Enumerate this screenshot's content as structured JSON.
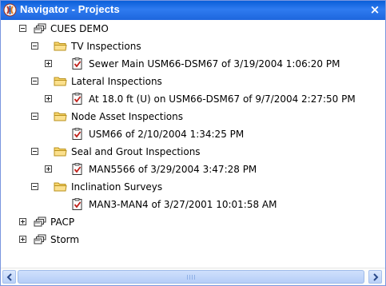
{
  "window": {
    "title": "Navigator - Projects",
    "close_glyph": "×",
    "colors": {
      "titlebar": "#1d66dd",
      "border": "#7a96df",
      "folder": "#f5c945"
    }
  },
  "tree": {
    "root": {
      "label": "CUES DEMO",
      "icon": "project-icon",
      "expanded": true
    },
    "folders": [
      {
        "label": "TV Inspections",
        "expanded": true,
        "items": [
          {
            "label": "Sewer Main USM66-DSM67 of 3/19/2004 1:06:20 PM",
            "expandable": true
          }
        ]
      },
      {
        "label": "Lateral Inspections",
        "expanded": true,
        "items": [
          {
            "label": "At 18.0 ft (U) on USM66-DSM67 of 9/7/2004 2:27:50 PM",
            "expandable": true
          }
        ]
      },
      {
        "label": "Node Asset Inspections",
        "expanded": true,
        "items": [
          {
            "label": "USM66 of 2/10/2004 1:34:25 PM",
            "expandable": false
          }
        ]
      },
      {
        "label": "Seal and Grout Inspections",
        "expanded": true,
        "items": [
          {
            "label": "MAN5566 of 3/29/2004 3:47:28 PM",
            "expandable": true
          }
        ]
      },
      {
        "label": "Inclination Surveys",
        "expanded": true,
        "items": [
          {
            "label": "MAN3-MAN4 of 3/27/2001 10:01:58 AM",
            "expandable": false
          }
        ]
      }
    ],
    "others": [
      {
        "label": "PACP",
        "icon": "project-icon",
        "expanded": false
      },
      {
        "label": "Storm",
        "icon": "project-icon",
        "expanded": false
      }
    ]
  }
}
